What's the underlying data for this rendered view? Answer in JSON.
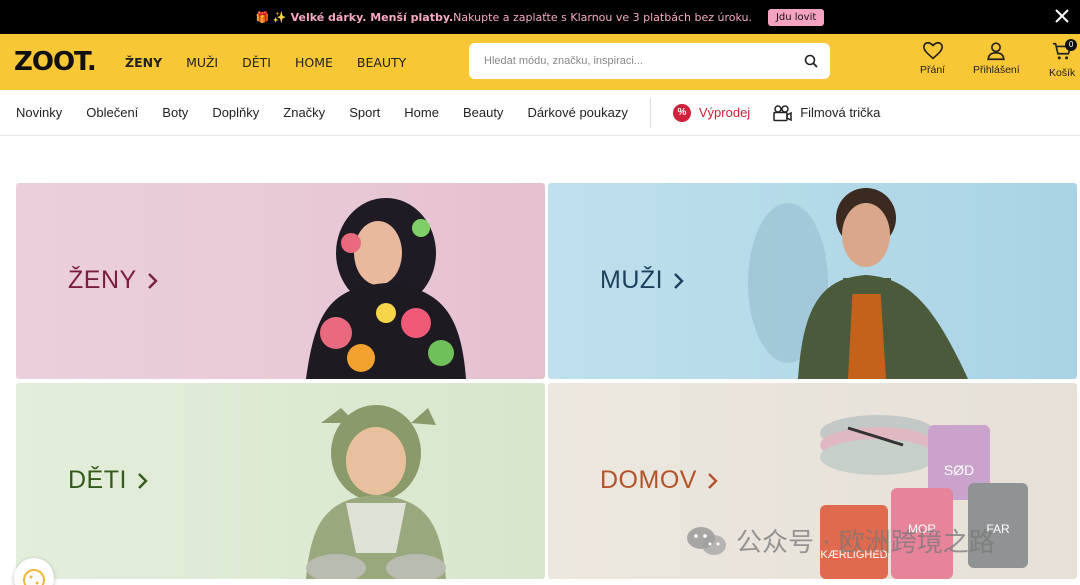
{
  "promo": {
    "emoji": "🎁 ✨",
    "bold": "Velké dárky. Menší platby.",
    "text": " Nakupte a zaplaťte s Klarnou ve 3 platbách bez úroku.",
    "cta": "Jdu lovit"
  },
  "header": {
    "logo": "ZOOT.",
    "nav": [
      "ŽENY",
      "MUŽI",
      "DĚTI",
      "HOME",
      "BEAUTY"
    ],
    "search_placeholder": "Hledat módu, značku, inspiraci...",
    "wishlist": "Přání",
    "login": "Přihlášení",
    "cart": "Košík",
    "cart_count": "0"
  },
  "subnav": {
    "links": [
      "Novinky",
      "Oblečení",
      "Boty",
      "Doplňky",
      "Značky",
      "Sport",
      "Home",
      "Beauty",
      "Dárkové poukazy"
    ],
    "sale": "Výprodej",
    "sale_badge": "%",
    "movie_tees": "Filmová trička"
  },
  "tiles": {
    "zeny": "ŽENY",
    "muzi": "MUŽI",
    "deti": "DĚTI",
    "domov": "DOMOV"
  },
  "mugs": {
    "sod": "SØD",
    "mor": "MOR",
    "far": "FAR",
    "kaerlighed": "KÆRLIGHED"
  },
  "watermark": "公众号 · 欧洲跨境之路",
  "colors": {
    "brand_yellow": "#f8c735",
    "zeny_text": "#7a1f3d",
    "muzi_text": "#1d3f5e",
    "deti_text": "#355a1c",
    "domov_text": "#b4532a",
    "sale_red": "#d0213a"
  }
}
